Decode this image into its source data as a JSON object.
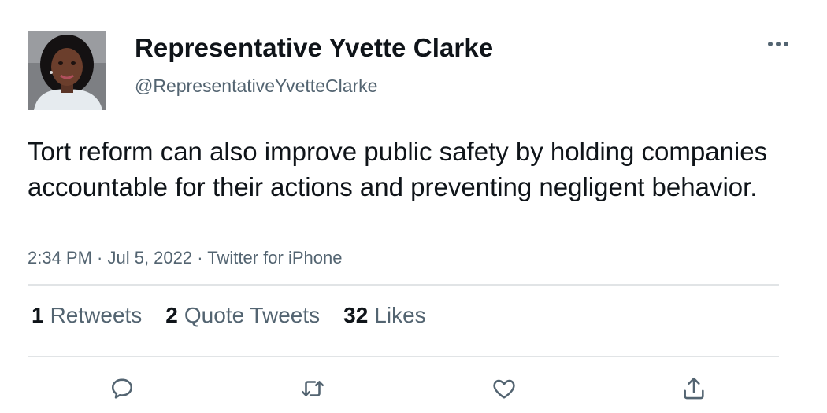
{
  "author": {
    "name": "Representative Yvette Clarke",
    "handle": "@RepresentativeYvetteClarke"
  },
  "tweet": {
    "text": "Tort reform can also improve public safety by holding companies accountable for their actions and preventing negligent behavior.",
    "meta": "2:34 PM · Jul 5, 2022 · Twitter for iPhone"
  },
  "stats": {
    "retweets": {
      "count": "1",
      "label": "Retweets"
    },
    "quotes": {
      "count": "2",
      "label": "Quote Tweets"
    },
    "likes": {
      "count": "32",
      "label": "Likes"
    }
  },
  "icons": {
    "more": "more-horizontal-icon",
    "reply": "reply-icon",
    "retweet": "retweet-icon",
    "like": "heart-icon",
    "share": "share-icon"
  },
  "colors": {
    "text": "#0f1419",
    "secondary": "#536471",
    "divider": "#e1e4e6"
  }
}
